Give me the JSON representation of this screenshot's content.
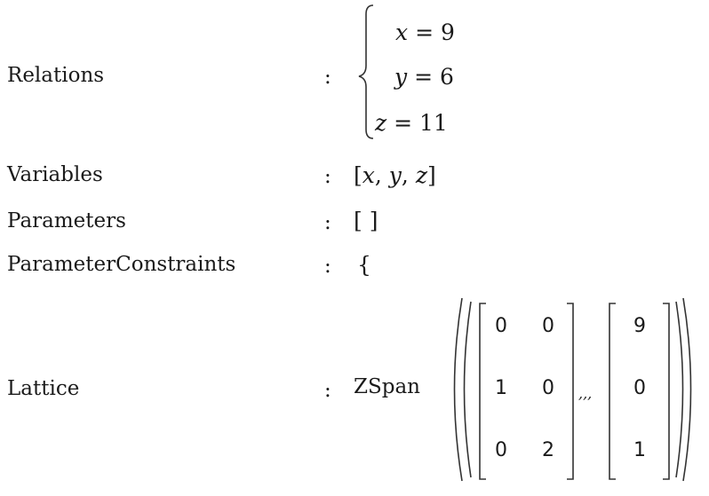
{
  "rows": {
    "relations": {
      "label": "Relations",
      "colon": ":"
    },
    "variables": {
      "label": "Variables",
      "colon": ":",
      "value": "[x, y, z]"
    },
    "parameters": {
      "label": "Parameters",
      "colon": ":",
      "value": "[ ]"
    },
    "parameter_constraints": {
      "label": "ParameterConstraints",
      "colon": ":",
      "value": "{"
    },
    "lattice": {
      "label": "Lattice",
      "colon": ":",
      "func": "ZSpan",
      "separator": ",,,"
    }
  },
  "relations": {
    "eq1": {
      "var": "x",
      "op": "=",
      "val": "9"
    },
    "eq2": {
      "var": "y",
      "op": "=",
      "val": "6"
    },
    "eq3": {
      "var": "z",
      "op": "=",
      "val": "11"
    }
  },
  "variables": [
    "x",
    "y",
    "z"
  ],
  "matrix": {
    "r0": [
      "0",
      "0"
    ],
    "r1": [
      "1",
      "0"
    ],
    "r2": [
      "0",
      "2"
    ]
  },
  "vector": [
    "9",
    "0",
    "1"
  ]
}
